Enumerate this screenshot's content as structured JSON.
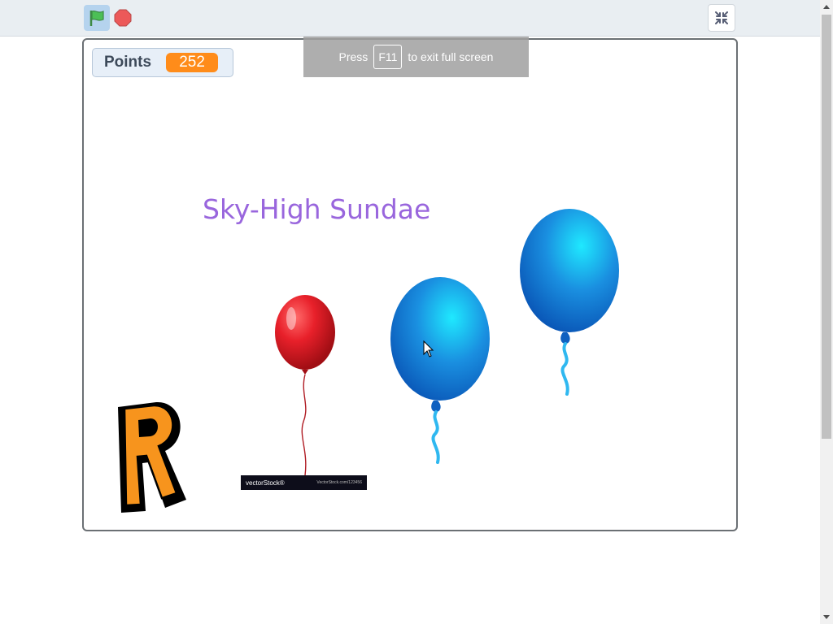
{
  "toolbar": {
    "green_flag_icon": "green-flag-icon",
    "stop_icon": "stop-sign-icon",
    "exit_fullscreen_icon": "exit-fullscreen-icon"
  },
  "monitor": {
    "label": "Points",
    "value": "252"
  },
  "fullscreen_hint": {
    "prefix": "Press",
    "key": "F11",
    "suffix": "to exit full screen"
  },
  "stage": {
    "title": "Sky-High Sundae",
    "watermark": {
      "brand": "vectorStock®",
      "url": "VectorStock.com/123456"
    }
  },
  "colors": {
    "flag": "#4cbf56",
    "stop": "#ec5959",
    "monitor_value": "#ff8c1a",
    "title": "#9966dd",
    "red_balloon": "#e8202a",
    "blue_balloon": "#1a8fe0",
    "letter_fill": "#f7941d"
  }
}
